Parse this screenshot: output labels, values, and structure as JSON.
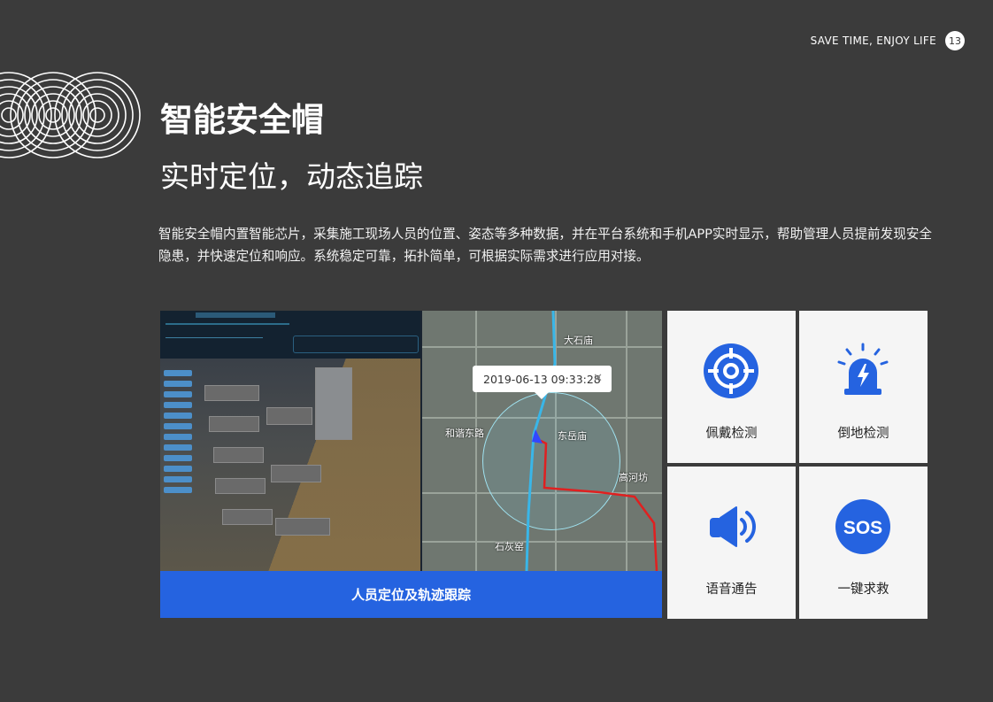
{
  "header": {
    "tagline": "SAVE TIME, ENJOY LIFE",
    "page_number": "13"
  },
  "title": "智能安全帽",
  "subtitle": "实时定位，动态追踪",
  "description": "智能安全帽内置智能芯片，采集施工现场人员的位置、姿态等多种数据，并在平台系统和手机APP实时显示，帮助管理人员提前发现安全隐患，并快速定位和响应。系统稳定可靠，拓扑简单，可根据实际需求进行应用对接。",
  "screenshot": {
    "map_popup": "2019-06-13 09:33:28",
    "map_popup_close": "✕",
    "map_labels": [
      "东岳庙",
      "石灰窑",
      "高河坊",
      "大石庙",
      "和谐东路"
    ],
    "caption": "人员定位及轨迹跟踪"
  },
  "features": [
    {
      "label": "佩戴检测",
      "icon": "crosshair-icon"
    },
    {
      "label": "倒地检测",
      "icon": "alarm-light-icon"
    },
    {
      "label": "语音通告",
      "icon": "speaker-icon"
    },
    {
      "label": "一键求救",
      "icon": "sos-icon",
      "icon_text": "SOS"
    }
  ],
  "colors": {
    "background": "#3b3b3b",
    "accent": "#2563e0",
    "card": "#f5f5f5"
  }
}
